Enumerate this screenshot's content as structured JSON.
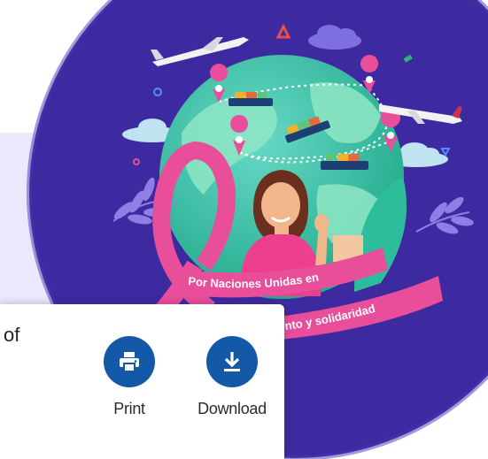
{
  "banner": {
    "ribbon_text_line1": "Por Naciones Unidas en",
    "ribbon_text_line2": "ento y solidaridad",
    "colors": {
      "circle": "#3e2aa0",
      "globe": "#2ebd9a",
      "ribbon": "#e94e9a",
      "band": "#ece8fb"
    }
  },
  "card": {
    "snippet_text": "of",
    "actions": [
      {
        "label": "Print",
        "icon": "printer-icon"
      },
      {
        "label": "Download",
        "icon": "download-icon"
      }
    ],
    "accent_color": "#1459a8"
  }
}
